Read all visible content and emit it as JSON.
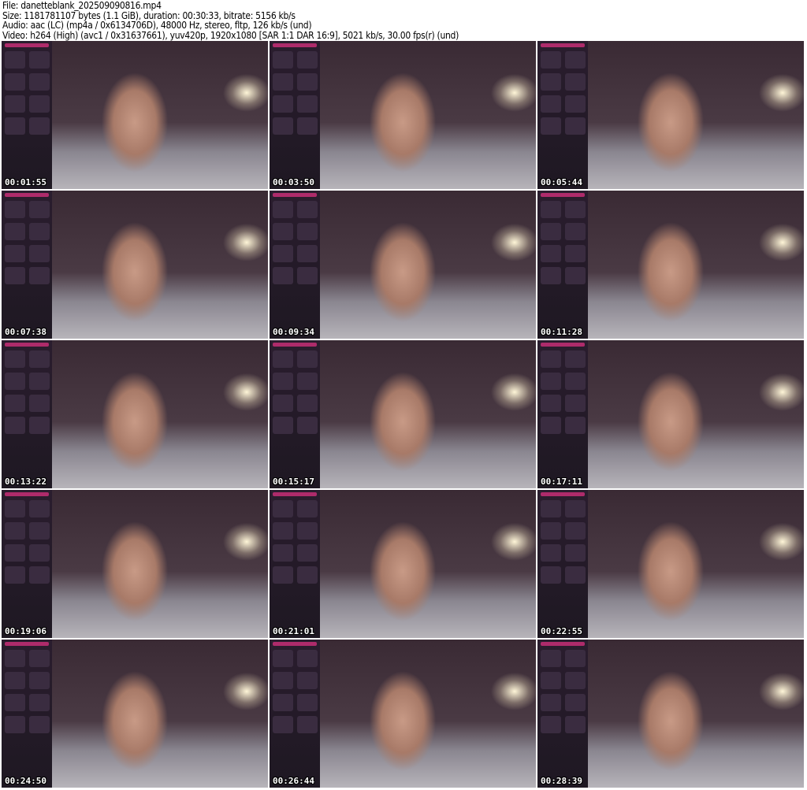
{
  "header": {
    "file": "File: danetteblank_202509090816.mp4",
    "size": "Size: 1181781107 bytes (1.1 GiB), duration: 00:30:33, bitrate: 5156 kb/s",
    "audio": "Audio: aac (LC) (mp4a / 0x6134706D), 48000 Hz, stereo, fltp, 126 kb/s (und)",
    "video": "Video: h264 (High) (avc1 / 0x31637661), yuv420p, 1920x1080 [SAR 1:1 DAR 16:9], 5021 kb/s, 30.00 fps(r) (und)"
  },
  "thumbnails": [
    {
      "timestamp": "00:01:55"
    },
    {
      "timestamp": "00:03:50"
    },
    {
      "timestamp": "00:05:44"
    },
    {
      "timestamp": "00:07:38"
    },
    {
      "timestamp": "00:09:34"
    },
    {
      "timestamp": "00:11:28"
    },
    {
      "timestamp": "00:13:22"
    },
    {
      "timestamp": "00:15:17"
    },
    {
      "timestamp": "00:17:11"
    },
    {
      "timestamp": "00:19:06"
    },
    {
      "timestamp": "00:21:01"
    },
    {
      "timestamp": "00:22:55"
    },
    {
      "timestamp": "00:24:50"
    },
    {
      "timestamp": "00:26:44"
    },
    {
      "timestamp": "00:28:39"
    }
  ]
}
